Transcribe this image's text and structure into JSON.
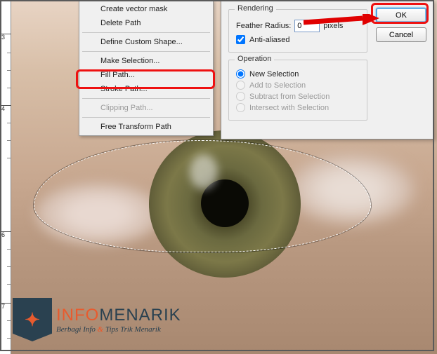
{
  "ruler": {
    "t1": "3",
    "t2": "4",
    "t3": "6",
    "t4": "7"
  },
  "menu": {
    "create_vector_mask": "Create vector mask",
    "delete_path": "Delete Path",
    "define_custom_shape": "Define Custom Shape...",
    "make_selection": "Make Selection...",
    "fill_path": "Fill Path...",
    "stroke_path": "Stroke Path...",
    "clipping_path": "Clipping Path...",
    "free_transform_path": "Free Transform Path"
  },
  "dialog": {
    "rendering_legend": "Rendering",
    "feather_label": "Feather Radius:",
    "feather_value": "0",
    "feather_unit": "pixels",
    "antialiased": "Anti-aliased",
    "operation_legend": "Operation",
    "op_new": "New Selection",
    "op_add": "Add to Selection",
    "op_sub": "Subtract from Selection",
    "op_int": "Intersect with Selection",
    "ok": "OK",
    "cancel": "Cancel"
  },
  "watermark": {
    "brand_a": "INFO",
    "brand_b": "MENARIK",
    "tag_a": "Berbagi Info",
    "amp": "&",
    "tag_b": "Tips Trik Menarik"
  }
}
